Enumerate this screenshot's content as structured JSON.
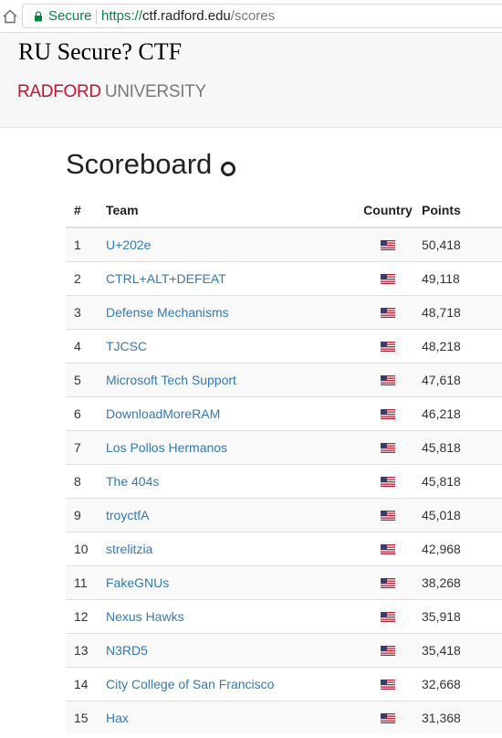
{
  "browser": {
    "secure_label": "Secure",
    "url_scheme": "https://",
    "url_host": "ctf.radford.edu",
    "url_path": "/scores"
  },
  "site": {
    "title": "RU Secure? CTF",
    "brand_primary": "RADFORD",
    "brand_secondary": "UNIVERSITY",
    "brand_primary_color": "#c8102e",
    "brand_secondary_color": "#7a7a7a"
  },
  "scoreboard": {
    "heading": "Scoreboard",
    "columns": {
      "rank": "#",
      "team": "Team",
      "country": "Country",
      "points": "Points"
    },
    "rows": [
      {
        "rank": "1",
        "team": "U+202e",
        "country": "us-flag",
        "points": "50,418"
      },
      {
        "rank": "2",
        "team": "CTRL+ALT+DEFEAT",
        "country": "us-flag",
        "points": "49,118"
      },
      {
        "rank": "3",
        "team": "Defense Mechanisms",
        "country": "us-flag",
        "points": "48,718"
      },
      {
        "rank": "4",
        "team": "TJCSC",
        "country": "us-flag",
        "points": "48,218"
      },
      {
        "rank": "5",
        "team": "Microsoft Tech Support",
        "country": "us-flag",
        "points": "47,618"
      },
      {
        "rank": "6",
        "team": "DownloadMoreRAM",
        "country": "us-flag",
        "points": "46,218"
      },
      {
        "rank": "7",
        "team": "Los Pollos Hermanos",
        "country": "us-flag",
        "points": "45,818"
      },
      {
        "rank": "8",
        "team": "The 404s",
        "country": "us-flag",
        "points": "45,818"
      },
      {
        "rank": "9",
        "team": "troyctfA",
        "country": "us-flag",
        "points": "45,018"
      },
      {
        "rank": "10",
        "team": "strelitzia",
        "country": "us-flag",
        "points": "42,968"
      },
      {
        "rank": "11",
        "team": "FakeGNUs",
        "country": "us-flag",
        "points": "38,268"
      },
      {
        "rank": "12",
        "team": "Nexus Hawks",
        "country": "us-flag",
        "points": "35,918"
      },
      {
        "rank": "13",
        "team": "N3RD5",
        "country": "us-flag",
        "points": "35,418"
      },
      {
        "rank": "14",
        "team": "City College of San Francisco",
        "country": "us-flag",
        "points": "32,668"
      },
      {
        "rank": "15",
        "team": "Hax",
        "country": "us-flag",
        "points": "31,368"
      }
    ]
  },
  "colors": {
    "link": "#337ab7",
    "secure_green": "#0b8043",
    "row_stripe": "#f9f9f9"
  }
}
